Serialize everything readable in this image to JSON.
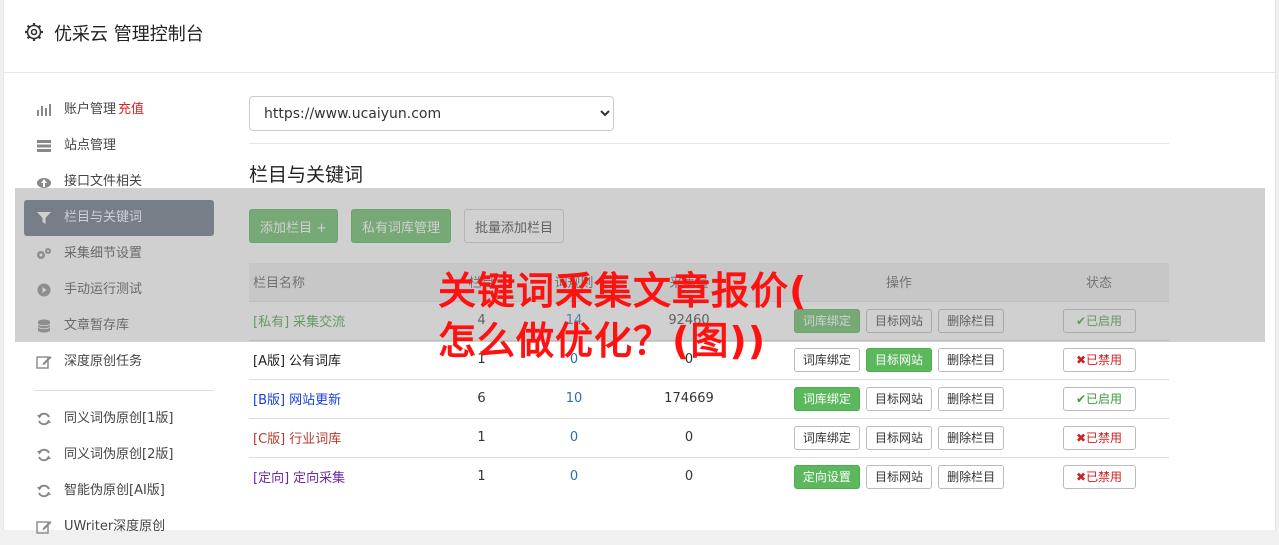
{
  "header": {
    "title": "优采云 管理控制台"
  },
  "sidebar": {
    "account_label": "账户管理",
    "recharge_label": "充值",
    "items": [
      {
        "label": "站点管理",
        "icon": "server-icon"
      },
      {
        "label": "接口文件相关",
        "icon": "cloud-upload-icon"
      },
      {
        "label": "栏目与关键词",
        "icon": "filter-icon"
      },
      {
        "label": "采集细节设置",
        "icon": "gears-icon"
      },
      {
        "label": "手动运行测试",
        "icon": "play-circle-icon"
      },
      {
        "label": "文章暂存库",
        "icon": "database-icon"
      },
      {
        "label": "深度原创任务",
        "icon": "edit-icon"
      }
    ],
    "rewrite_items": [
      {
        "label": "同义词伪原创[1版]"
      },
      {
        "label": "同义词伪原创[2版]"
      },
      {
        "label": "智能伪原创[AI版]"
      },
      {
        "label": "UWriter深度原创"
      }
    ]
  },
  "main": {
    "site_select": "https://www.ucaiyun.com",
    "section_title": "栏目与关键词",
    "buttons": {
      "add_column": "添加栏目 +",
      "private_lexicon": "私有词库管理",
      "batch_add": "批量添加栏目"
    },
    "table": {
      "headers": {
        "name": "栏目名称",
        "col2": "栏目",
        "col3": "词规则",
        "col4": "采集量",
        "ops": "操作",
        "status": "状态"
      },
      "rows": [
        {
          "tag": "[私有]",
          "name": "采集交流",
          "a": "4",
          "b": "14",
          "c": "92460",
          "op1": "词库绑定",
          "op2": "目标网站",
          "op3": "删除栏目",
          "status": "✔已启用"
        },
        {
          "tag": "[A版]",
          "name": "公有词库",
          "a": "1",
          "b": "0",
          "c": "0",
          "op1": "词库绑定",
          "op2": "目标网站",
          "op3": "删除栏目",
          "status": "✖已禁用"
        },
        {
          "tag": "[B版]",
          "name": "网站更新",
          "a": "6",
          "b": "10",
          "c": "174669",
          "op1": "词库绑定",
          "op2": "目标网站",
          "op3": "删除栏目",
          "status": "✔已启用"
        },
        {
          "tag": "[C版]",
          "name": "行业词库",
          "a": "1",
          "b": "0",
          "c": "0",
          "op1": "词库绑定",
          "op2": "目标网站",
          "op3": "删除栏目",
          "status": "✖已禁用"
        },
        {
          "tag": "[定向]",
          "name": "定向采集",
          "a": "1",
          "b": "0",
          "c": "0",
          "op1": "定向设置",
          "op2": "目标网站",
          "op3": "删除栏目",
          "status": "✖已禁用"
        }
      ]
    }
  },
  "overlay": {
    "line1": "关键词采集文章报价(",
    "line2": "怎么做优化？(图))"
  },
  "colors": {
    "accent_green": "#5cb85c",
    "sidebar_active": "#5f6b7a",
    "overlay_red": "#ff1111"
  }
}
